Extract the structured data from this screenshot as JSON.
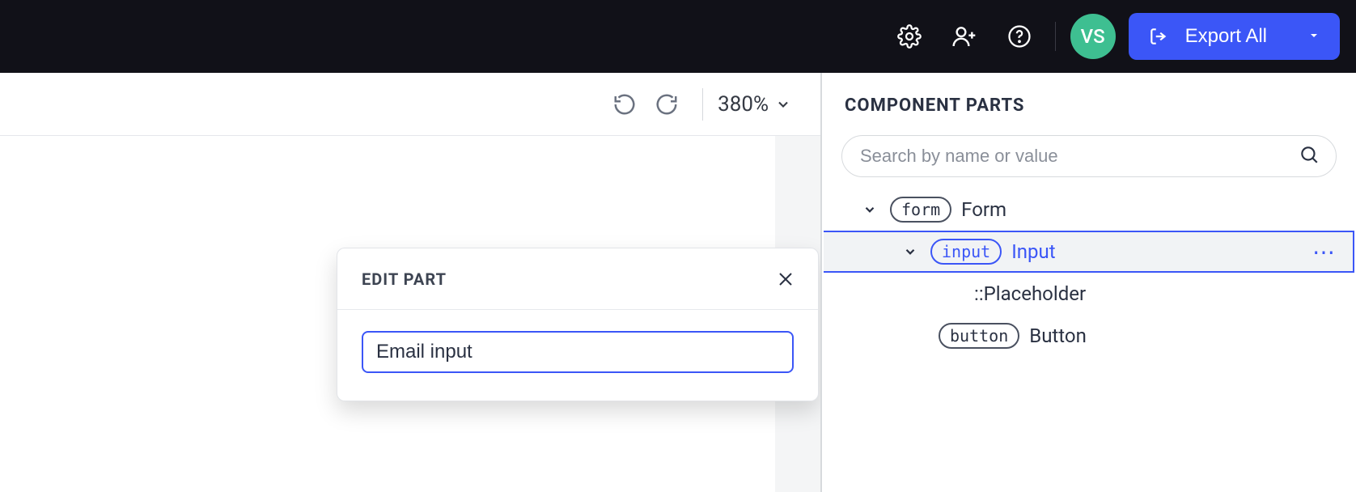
{
  "header": {
    "avatar_initials": "VS",
    "export_label": "Export All"
  },
  "toolbar": {
    "zoom_label": "380%"
  },
  "panel": {
    "title": "COMPONENT PARTS",
    "search_placeholder": "Search by name or value",
    "tree": {
      "form_tag": "form",
      "form_label": "Form",
      "input_tag": "input",
      "input_label": "Input",
      "placeholder_label": "::Placeholder",
      "button_tag": "button",
      "button_label": "Button"
    }
  },
  "popover": {
    "title": "EDIT PART",
    "value": "Email input"
  }
}
